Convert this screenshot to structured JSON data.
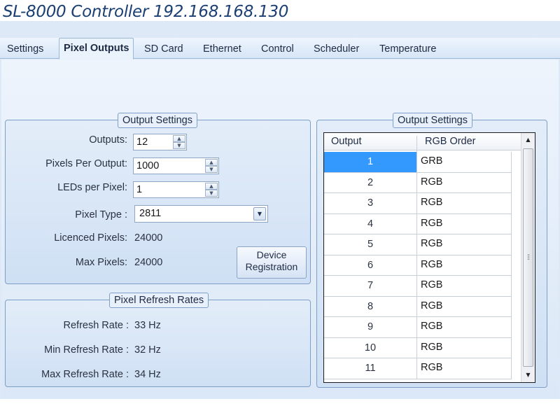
{
  "window": {
    "title": "SL-8000 Controller 192.168.168.130"
  },
  "tabs": [
    {
      "label": "Settings"
    },
    {
      "label": "Pixel Outputs",
      "active": true
    },
    {
      "label": "SD Card"
    },
    {
      "label": "Ethernet"
    },
    {
      "label": "Control"
    },
    {
      "label": "Scheduler"
    },
    {
      "label": "Temperature"
    }
  ],
  "output_settings": {
    "title": "Output Settings",
    "outputs_label": "Outputs:",
    "outputs_value": "12",
    "pixels_per_output_label": "Pixels Per Output:",
    "pixels_per_output_value": "1000",
    "leds_per_pixel_label": "LEDs per Pixel:",
    "leds_per_pixel_value": "1",
    "pixel_type_label": "Pixel Type :",
    "pixel_type_value": "2811",
    "licenced_pixels_label": "Licenced Pixels:",
    "licenced_pixels_value": "24000",
    "max_pixels_label": "Max Pixels:",
    "max_pixels_value": "24000",
    "device_registration_line1": "Device",
    "device_registration_line2": "Registration"
  },
  "refresh_rates": {
    "title": "Pixel Refresh Rates",
    "refresh_rate_label": "Refresh Rate :",
    "refresh_rate_value": "33 Hz",
    "min_refresh_rate_label": "Min Refresh Rate :",
    "min_refresh_rate_value": "32 Hz",
    "max_refresh_rate_label": "Max Refresh Rate :",
    "max_refresh_rate_value": "34 Hz"
  },
  "output_grid": {
    "title": "Output Settings",
    "col_output": "Output",
    "col_rgb_order": "RGB Order",
    "rows": [
      {
        "output": "1",
        "rgb": "GRB"
      },
      {
        "output": "2",
        "rgb": "RGB"
      },
      {
        "output": "3",
        "rgb": "RGB"
      },
      {
        "output": "4",
        "rgb": "RGB"
      },
      {
        "output": "5",
        "rgb": "RGB"
      },
      {
        "output": "6",
        "rgb": "RGB"
      },
      {
        "output": "7",
        "rgb": "RGB"
      },
      {
        "output": "8",
        "rgb": "RGB"
      },
      {
        "output": "9",
        "rgb": "RGB"
      },
      {
        "output": "10",
        "rgb": "RGB"
      },
      {
        "output": "11",
        "rgb": "RGB"
      }
    ],
    "selected_row": 0
  },
  "icons": {
    "spin_up": "triangle-up-icon",
    "spin_down": "triangle-down-icon",
    "combo_drop": "chevron-down-icon",
    "scroll_up": "scroll-up-icon",
    "scroll_down": "scroll-down-icon"
  },
  "colors": {
    "title": "#1c3f74",
    "selection": "#3399ff",
    "window_bg": "#dde9f7"
  }
}
